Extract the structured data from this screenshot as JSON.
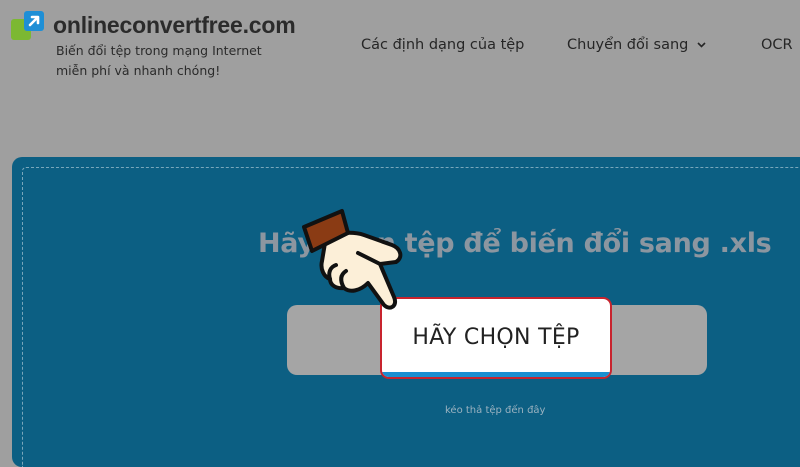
{
  "header": {
    "site_name": "onlineconvertfree.com",
    "tagline": "Biến đổi tệp trong mạng Internet miễn phí và nhanh chóng!",
    "nav": [
      {
        "label": "Các định dạng của tệp"
      },
      {
        "label": "Chuyển đổi sang",
        "icon": "chevron-down-icon"
      },
      {
        "label": "OCR"
      }
    ]
  },
  "main": {
    "title": "Hãy chọn tệp để biến đổi sang .xls",
    "choose_button": "HÃY CHỌN TỆP",
    "drop_hint": "kéo thả tệp đến đây"
  },
  "overlay": {
    "icon": "pointing-hand-icon"
  },
  "colors": {
    "page_background": "#9f9f9f",
    "drop_area": "#0c5f83",
    "button_border": "#c8242e",
    "button_strip": "#1b8fd0",
    "logo_blue": "#1e8fd6",
    "logo_green": "#7cb832"
  }
}
